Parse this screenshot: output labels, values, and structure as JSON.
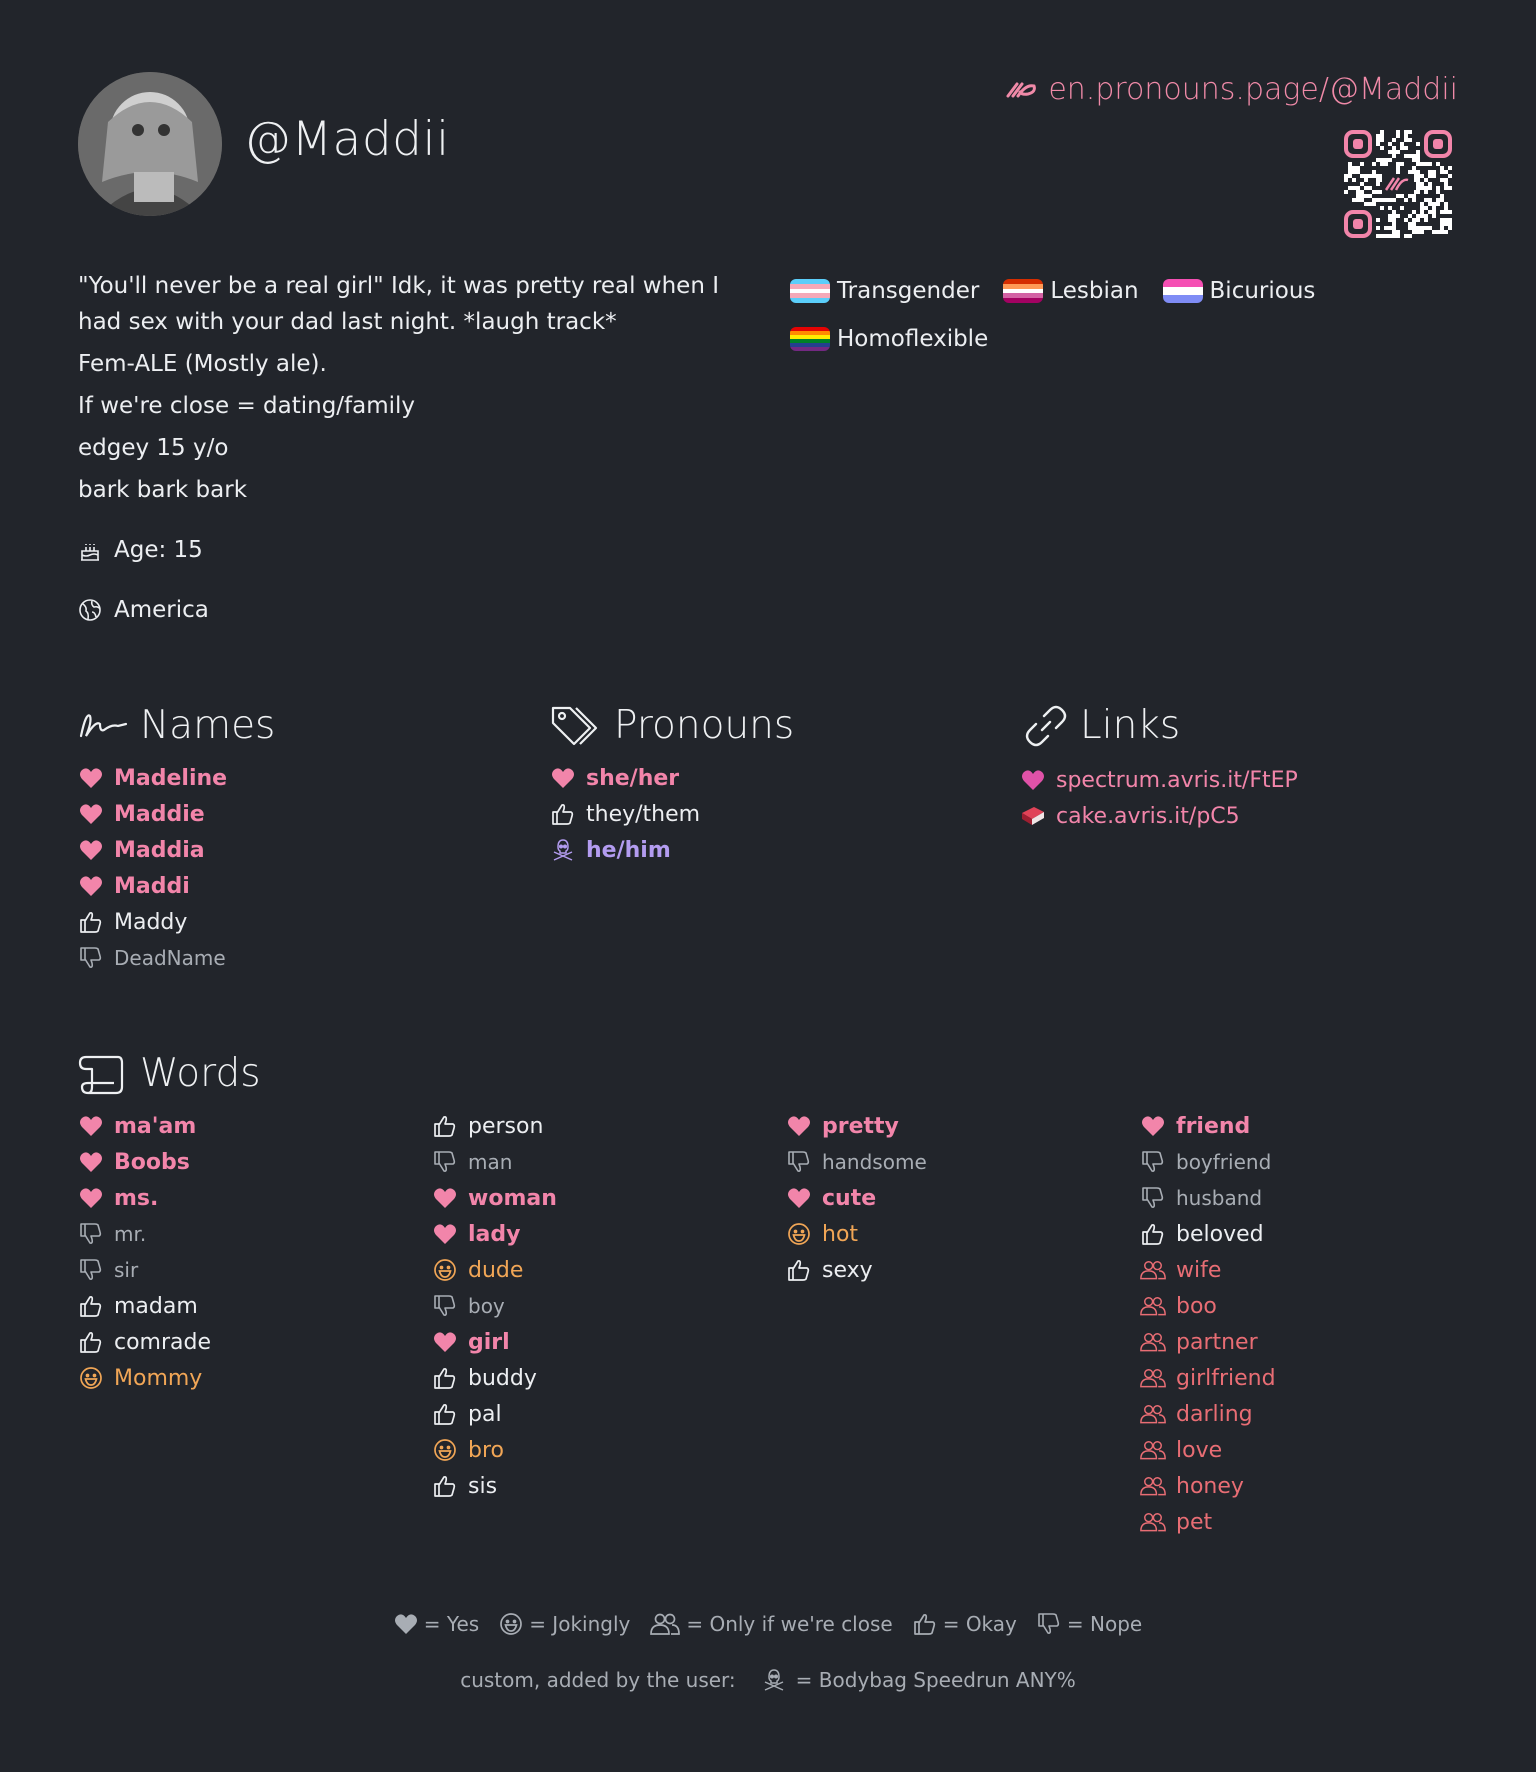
{
  "profile": {
    "username": "@Maddii",
    "site_link": "en.pronouns.page/@Maddii"
  },
  "bio": {
    "lines": [
      "\"You'll never be a real girl\" Idk, it was pretty real when I had sex with your dad last night. *laugh track*",
      "Fem-ALE (Mostly ale).",
      "If we're close = dating/family",
      "edgey 15 y/o",
      "bark bark bark"
    ],
    "age": "Age: 15",
    "location": "America"
  },
  "flags": [
    {
      "label": "Transgender",
      "colors": [
        "#5bcefa",
        "#f5a9b8",
        "#ffffff",
        "#f5a9b8",
        "#5bcefa"
      ]
    },
    {
      "label": "Lesbian",
      "colors": [
        "#d52d00",
        "#ff9a56",
        "#ffffff",
        "#d362a4",
        "#a30262"
      ]
    },
    {
      "label": "Bicurious",
      "colors": [
        "#f54fb3",
        "#ffffff",
        "#7f8cf5"
      ]
    },
    {
      "label": "Homoflexible",
      "colors": [
        "#e40303",
        "#ff8c00",
        "#ffed00",
        "#008026",
        "#24408e",
        "#732982"
      ]
    }
  ],
  "sections": {
    "names_title": "Names",
    "pronouns_title": "Pronouns",
    "links_title": "Links",
    "words_title": "Words"
  },
  "names": [
    {
      "text": "Madeline",
      "opinion": "yes"
    },
    {
      "text": "Maddie",
      "opinion": "yes"
    },
    {
      "text": "Maddia",
      "opinion": "yes"
    },
    {
      "text": "Maddi",
      "opinion": "yes"
    },
    {
      "text": "Maddy",
      "opinion": "okay"
    },
    {
      "text": "DeadName",
      "opinion": "nope"
    }
  ],
  "pronouns": [
    {
      "text": "she/her",
      "opinion": "yes"
    },
    {
      "text": "they/them",
      "opinion": "okay"
    },
    {
      "text": "he/him",
      "opinion": "custom"
    }
  ],
  "links": [
    {
      "text": "spectrum.avris.it/FtEP",
      "icon": "heart-icon"
    },
    {
      "text": "cake.avris.it/pC5",
      "icon": "book-icon"
    }
  ],
  "words": [
    [
      {
        "text": "ma'am",
        "opinion": "yes"
      },
      {
        "text": "Boobs",
        "opinion": "yes"
      },
      {
        "text": "ms.",
        "opinion": "yes"
      },
      {
        "text": "mr.",
        "opinion": "nope"
      },
      {
        "text": "sir",
        "opinion": "nope"
      },
      {
        "text": "madam",
        "opinion": "okay"
      },
      {
        "text": "comrade",
        "opinion": "okay"
      },
      {
        "text": "Mommy",
        "opinion": "joke"
      }
    ],
    [
      {
        "text": "person",
        "opinion": "okay"
      },
      {
        "text": "man",
        "opinion": "nope"
      },
      {
        "text": "woman",
        "opinion": "yes"
      },
      {
        "text": "lady",
        "opinion": "yes"
      },
      {
        "text": "dude",
        "opinion": "joke"
      },
      {
        "text": "boy",
        "opinion": "nope"
      },
      {
        "text": "girl",
        "opinion": "yes"
      },
      {
        "text": "buddy",
        "opinion": "okay"
      },
      {
        "text": "pal",
        "opinion": "okay"
      },
      {
        "text": "bro",
        "opinion": "joke"
      },
      {
        "text": "sis",
        "opinion": "okay"
      }
    ],
    [
      {
        "text": "pretty",
        "opinion": "yes"
      },
      {
        "text": "handsome",
        "opinion": "nope"
      },
      {
        "text": "cute",
        "opinion": "yes"
      },
      {
        "text": "hot",
        "opinion": "joke"
      },
      {
        "text": "sexy",
        "opinion": "okay"
      }
    ],
    [
      {
        "text": "friend",
        "opinion": "yes"
      },
      {
        "text": "boyfriend",
        "opinion": "nope"
      },
      {
        "text": "husband",
        "opinion": "nope"
      },
      {
        "text": "beloved",
        "opinion": "okay"
      },
      {
        "text": "wife",
        "opinion": "close"
      },
      {
        "text": "boo",
        "opinion": "close"
      },
      {
        "text": "partner",
        "opinion": "close"
      },
      {
        "text": "girlfriend",
        "opinion": "close"
      },
      {
        "text": "darling",
        "opinion": "close"
      },
      {
        "text": "love",
        "opinion": "close"
      },
      {
        "text": "honey",
        "opinion": "close"
      },
      {
        "text": "pet",
        "opinion": "close"
      }
    ]
  ],
  "legend": {
    "yes": "= Yes",
    "joke": "= Jokingly",
    "close": "= Only if we're close",
    "okay": "= Okay",
    "nope": "= Nope",
    "custom_intro": "custom, added by the user:",
    "custom": "= Bodybag Speedrun ANY%"
  },
  "colors": {
    "background": "#22252b",
    "yes": "#f285aa",
    "joke": "#f1a656",
    "close": "#e86d74",
    "custom": "#b39cf0",
    "nope": "#a8adb4"
  }
}
